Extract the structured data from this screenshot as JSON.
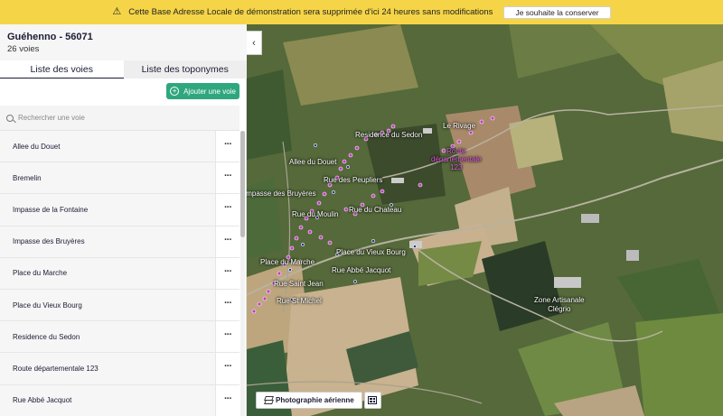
{
  "banner": {
    "message": "Cette Base Adresse Locale de démonstration sera supprimée d'ici 24 heures sans modifications",
    "keep_label": "Je souhaite la conserver"
  },
  "commune": {
    "title": "Guéhenno - 56071",
    "count": "26 voies"
  },
  "tabs": [
    {
      "label": "Liste des voies",
      "active": true
    },
    {
      "label": "Liste des toponymes",
      "active": false
    }
  ],
  "add_button": {
    "label": "Ajouter une voie"
  },
  "search": {
    "placeholder": "Rechercher une voie"
  },
  "voies": [
    {
      "name": "Allee du Douet",
      "menu": "···"
    },
    {
      "name": "Bremelin",
      "menu": "···"
    },
    {
      "name": "Impasse de la Fontaine",
      "menu": "···"
    },
    {
      "name": "Impasse des Bruyères",
      "menu": "···"
    },
    {
      "name": "Place du Marche",
      "menu": "···"
    },
    {
      "name": "Place du Vieux Bourg",
      "menu": "···"
    },
    {
      "name": "Residence du Sedon",
      "menu": "···"
    },
    {
      "name": "Route départementale 123",
      "menu": "···"
    },
    {
      "name": "Rue Abbé Jacquot",
      "menu": "···"
    }
  ],
  "map": {
    "collapse_glyph": "‹",
    "layer_button": "Photographie aérienne",
    "labels": {
      "le_rivage": "Le Rivage",
      "residence_sedon": "Residence du Sedon",
      "route_dep_line1": "Route",
      "route_dep_line2": "départementale",
      "route_dep_line3": "123",
      "allee_douet": "Allee du Douet",
      "rue_peupliers": "Rue des Peupliers",
      "impasse_bruyeres": "Impasse des Bruyères",
      "rue_moulin": "Rue du Moulin",
      "rue_chateau": "Rue du Chateau",
      "place_vieux_bourg": "Place du Vieux Bourg",
      "place_marche": "Place du Marche",
      "rue_abbe_jacquot": "Rue Abbé Jacquot",
      "rue_saint_jean": "Rue Saint Jean",
      "rue_st_michel": "Rue St Michel",
      "zone_artisanale_line1": "Zone Artisanale",
      "zone_artisanale_line2": "Clégrio"
    },
    "colors": {
      "brand_green": "#2fa77e",
      "banner_yellow": "#f5d547",
      "address_marker": "#c43cc4"
    }
  }
}
